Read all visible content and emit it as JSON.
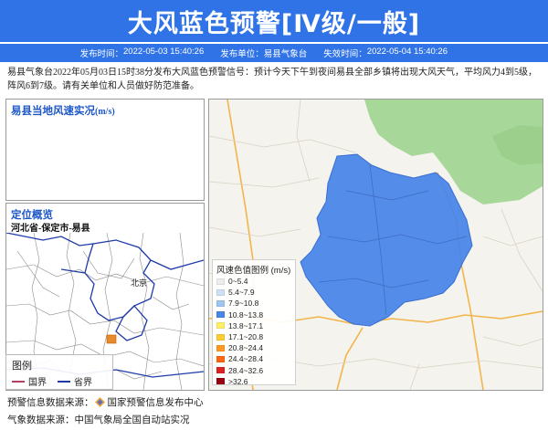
{
  "header": {
    "title": "大风蓝色预警[Ⅳ级/一般]",
    "publish_label": "发布时间：",
    "publish_time": "2022-05-03 15:40:26",
    "unit_label": "发布单位：",
    "unit": "易县气象台",
    "expire_label": "失效时间：",
    "expire_time": "2022-05-04 15:40:26"
  },
  "description": "易县气象台2022年05月03日15时38分发布大风蓝色预警信号：预计今天下午到夜间易县全部乡镇将出现大风天气，平均风力4到5级，阵风6到7级。请有关单位和人员做好防范准备。",
  "wind_panel": {
    "title": "易县当地风速实况",
    "unit": "(m/s)"
  },
  "location_panel": {
    "title": "定位概览",
    "path": "河北省-保定市-易县",
    "city_label": "北京",
    "legend_title": "图例",
    "legend_national": "国界",
    "legend_provincial": "省界"
  },
  "legend": {
    "title": "风速色值图例 (m/s)",
    "items": [
      {
        "label": "0~5.4",
        "color": "#ededed"
      },
      {
        "label": "5.4~7.9",
        "color": "#cfe0f5"
      },
      {
        "label": "7.9~10.8",
        "color": "#9fc6ee"
      },
      {
        "label": "10.8~13.8",
        "color": "#4a86e8"
      },
      {
        "label": "13.8~17.1",
        "color": "#ffee66"
      },
      {
        "label": "17.1~20.8",
        "color": "#ffcc33"
      },
      {
        "label": "20.8~24.4",
        "color": "#ff9922"
      },
      {
        "label": "24.4~28.4",
        "color": "#ff6611"
      },
      {
        "label": "28.4~32.6",
        "color": "#dd2222"
      },
      {
        "label": ">32.6",
        "color": "#990011"
      }
    ]
  },
  "footer": {
    "warning_source_label": "预警信息数据来源：",
    "warning_source": "国家预警信息发布中心",
    "weather_source_label": "气象数据来源：",
    "weather_source": "中国气象局全国自动站实况"
  },
  "colors": {
    "brand_blue": "#2f73e6",
    "panel_title": "#1d57c8",
    "warning_area": "#4a86e8",
    "forest": "#a7d89a"
  }
}
